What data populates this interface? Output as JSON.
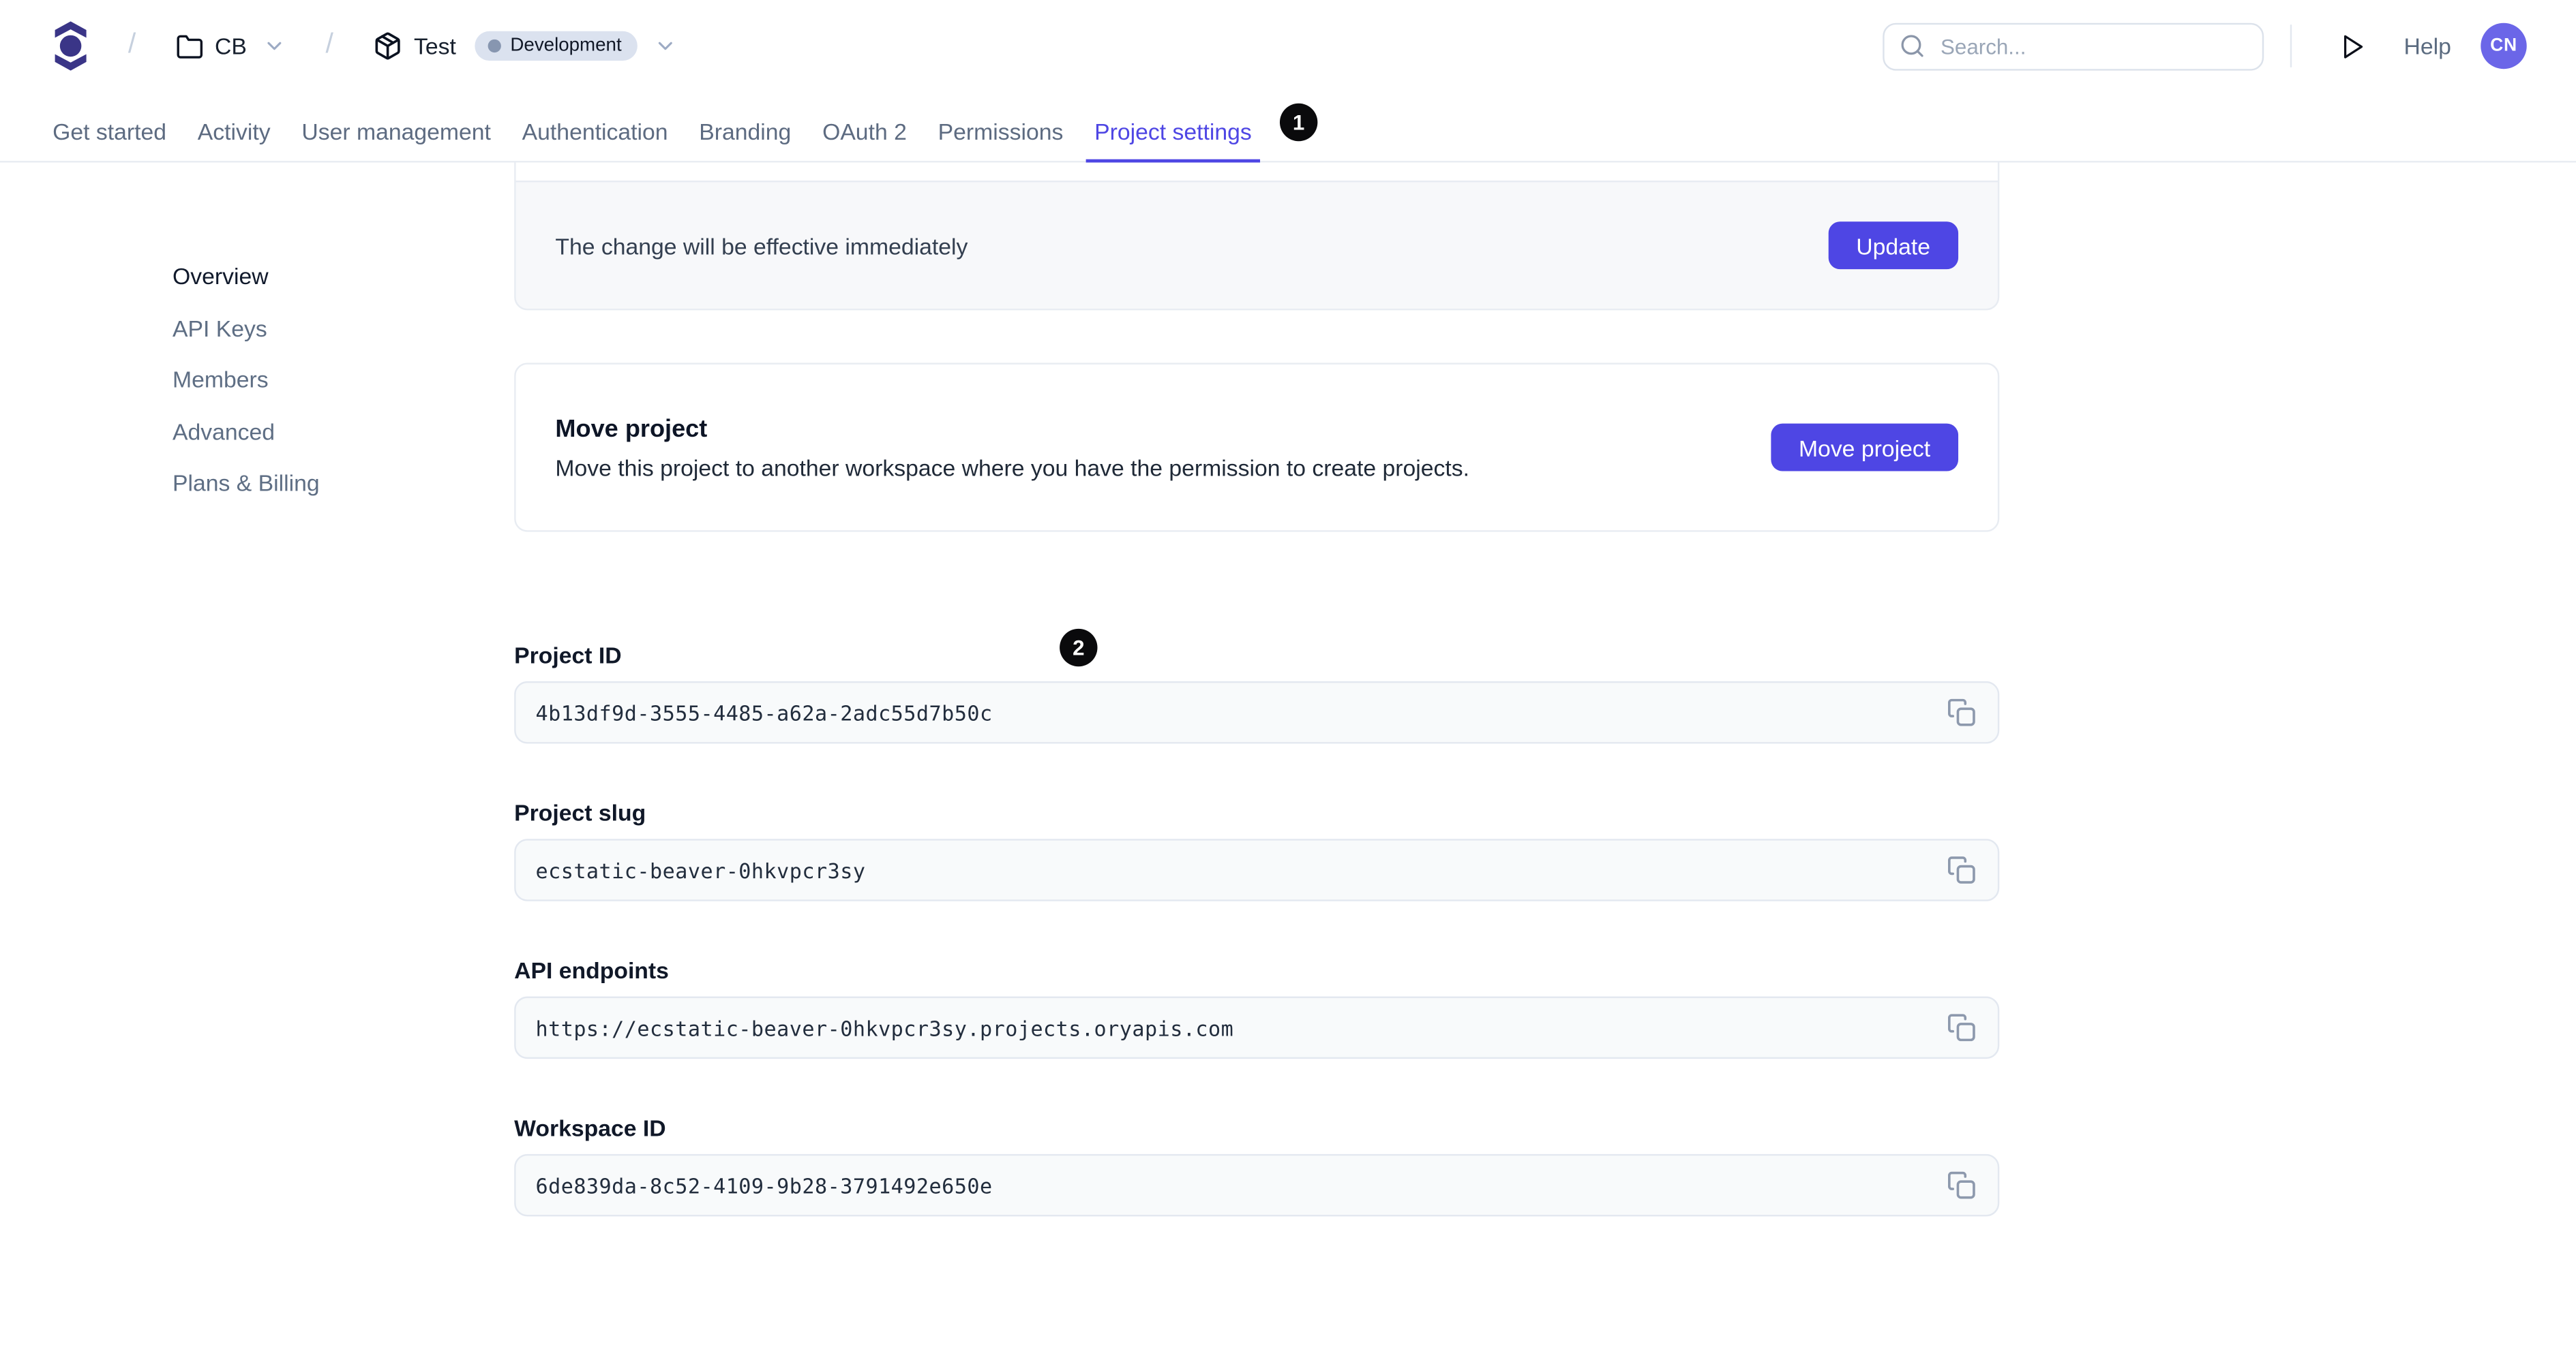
{
  "header": {
    "breadcrumb": {
      "separator": "/",
      "workspace": "CB",
      "project": "Test",
      "environment": "Development"
    },
    "search": {
      "placeholder": "Search..."
    },
    "help_label": "Help",
    "avatar_initials": "CN"
  },
  "tabs": {
    "items": [
      {
        "label": "Get started",
        "active": false
      },
      {
        "label": "Activity",
        "active": false
      },
      {
        "label": "User management",
        "active": false
      },
      {
        "label": "Authentication",
        "active": false
      },
      {
        "label": "Branding",
        "active": false
      },
      {
        "label": "OAuth 2",
        "active": false
      },
      {
        "label": "Permissions",
        "active": false
      },
      {
        "label": "Project settings",
        "active": true
      }
    ]
  },
  "annotations": {
    "badge1": "1",
    "badge2": "2"
  },
  "sidebar": {
    "items": [
      {
        "label": "Overview",
        "active": true
      },
      {
        "label": "API Keys",
        "active": false
      },
      {
        "label": "Members",
        "active": false
      },
      {
        "label": "Advanced",
        "active": false
      },
      {
        "label": "Plans & Billing",
        "active": false
      }
    ]
  },
  "main": {
    "update_card": {
      "message": "The change will be effective immediately",
      "button_label": "Update"
    },
    "move_card": {
      "title": "Move project",
      "description": "Move this project to another workspace where you have the permission to create projects.",
      "button_label": "Move project"
    },
    "fields": [
      {
        "label": "Project ID",
        "value": "4b13df9d-3555-4485-a62a-2adc55d7b50c"
      },
      {
        "label": "Project slug",
        "value": "ecstatic-beaver-0hkvpcr3sy"
      },
      {
        "label": "API endpoints",
        "value": "https://ecstatic-beaver-0hkvpcr3sy.projects.oryapis.com"
      },
      {
        "label": "Workspace ID",
        "value": "6de839da-8c52-4109-9b28-3791492e650e"
      }
    ]
  },
  "colors": {
    "accent": "#4e46e4",
    "logo": "#3a3587",
    "avatar": "#6b66e8",
    "annotation_badge": "#0a0a0c",
    "environment_badge_bg": "#dbe2ef",
    "field_bg": "#f8fafb"
  }
}
